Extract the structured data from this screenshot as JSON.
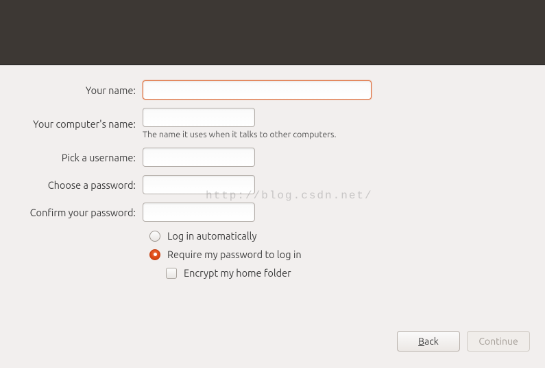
{
  "labels": {
    "your_name": "Your name:",
    "computer_name": "Your computer's name:",
    "computer_hint": "The name it uses when it talks to other computers.",
    "username": "Pick a username:",
    "password": "Choose a password:",
    "confirm": "Confirm your password:"
  },
  "values": {
    "your_name": "",
    "computer_name": "",
    "username": "",
    "password": "",
    "confirm": ""
  },
  "options": {
    "auto_login": "Log in automatically",
    "require_pw": "Require my password to log in",
    "encrypt": "Encrypt my home folder",
    "selected": "require_pw",
    "encrypt_checked": false
  },
  "buttons": {
    "back_prefix": "",
    "back_accel": "B",
    "back_suffix": "ack",
    "continue": "Continue"
  },
  "watermark": "http://blog.csdn.net/"
}
